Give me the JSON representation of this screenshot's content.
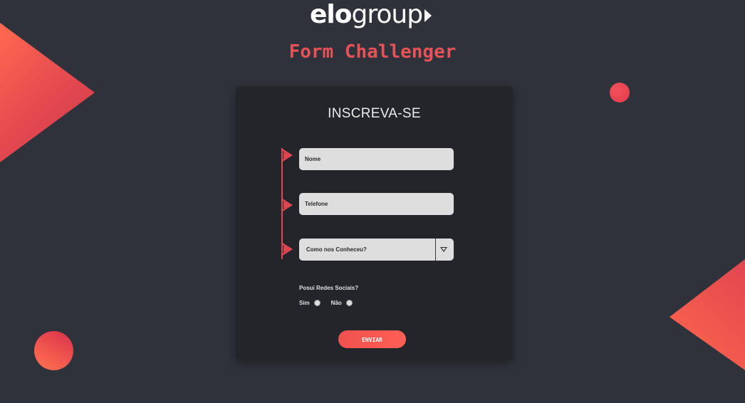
{
  "header": {
    "logo_bold": "elo",
    "logo_light": "group",
    "page_title": "Form Challenger"
  },
  "form": {
    "title": "INSCREVA-SE",
    "fields": {
      "nome": {
        "placeholder": "Nome"
      },
      "telefone": {
        "placeholder": "Telefone"
      },
      "como_conheceu": {
        "selected": "Como nos Conheceu?"
      }
    },
    "social_question": "Posui Redes Sociais?",
    "radio_options": [
      "Sim",
      "Não"
    ],
    "submit_label": "ENVIAR"
  },
  "colors": {
    "background": "#2f323a",
    "card": "#23252b",
    "accent": "#e55257",
    "field": "#dedede"
  },
  "icons": [
    "logo-arrow-icon",
    "chevron-down-icon"
  ]
}
